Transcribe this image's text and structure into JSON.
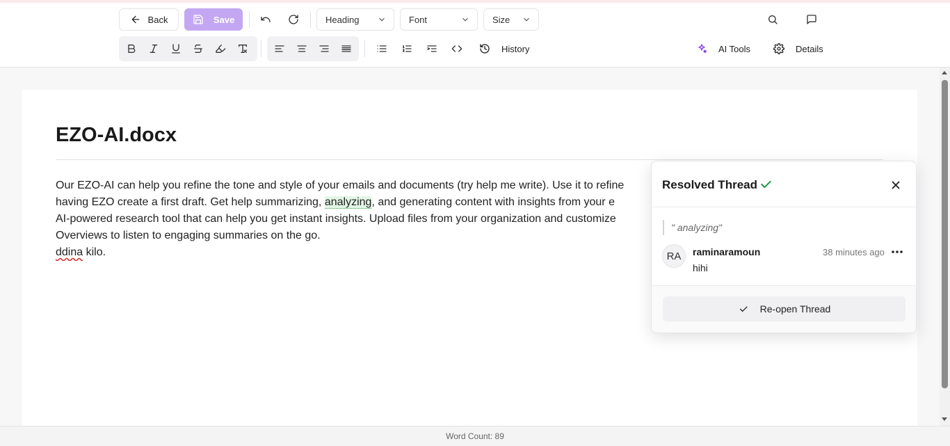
{
  "toolbar": {
    "back_label": "Back",
    "save_label": "Save",
    "heading_select": "Heading",
    "font_select": "Font",
    "size_select": "Size",
    "history_label": "History",
    "ai_tools_label": "AI Tools",
    "details_label": "Details"
  },
  "document": {
    "title": "EZO-AI.docx",
    "lines": [
      "Our EZO-AI can help you refine the tone and style of your emails and documents (try help me write). Use it to refine",
      "AI-powered research tool that can help you get instant insights. Upload files from your organization and customize",
      "Overviews to listen to engaging summaries on the go."
    ],
    "line2_pre": "having EZO create a first draft. Get help summarizing,",
    "line2_highlight": "analyzing",
    "line2_post": ", and generating content with insights from your e",
    "line5_misspelled": "ddina",
    "line5_rest": " kilo."
  },
  "thread": {
    "title": "Resolved Thread",
    "quote": "\" analyzing\"",
    "avatar": "RA",
    "author": "raminaramoun",
    "time": "38 minutes ago",
    "comment": "hihi",
    "reopen_label": "Re-open Thread"
  },
  "footer": {
    "word_count": "Word Count: 89"
  },
  "colors": {
    "save_bg": "#c4a7f3",
    "ai_icon": "#7c3aed",
    "resolved_check": "#22a04a",
    "highlight": "#e3f6e6"
  }
}
